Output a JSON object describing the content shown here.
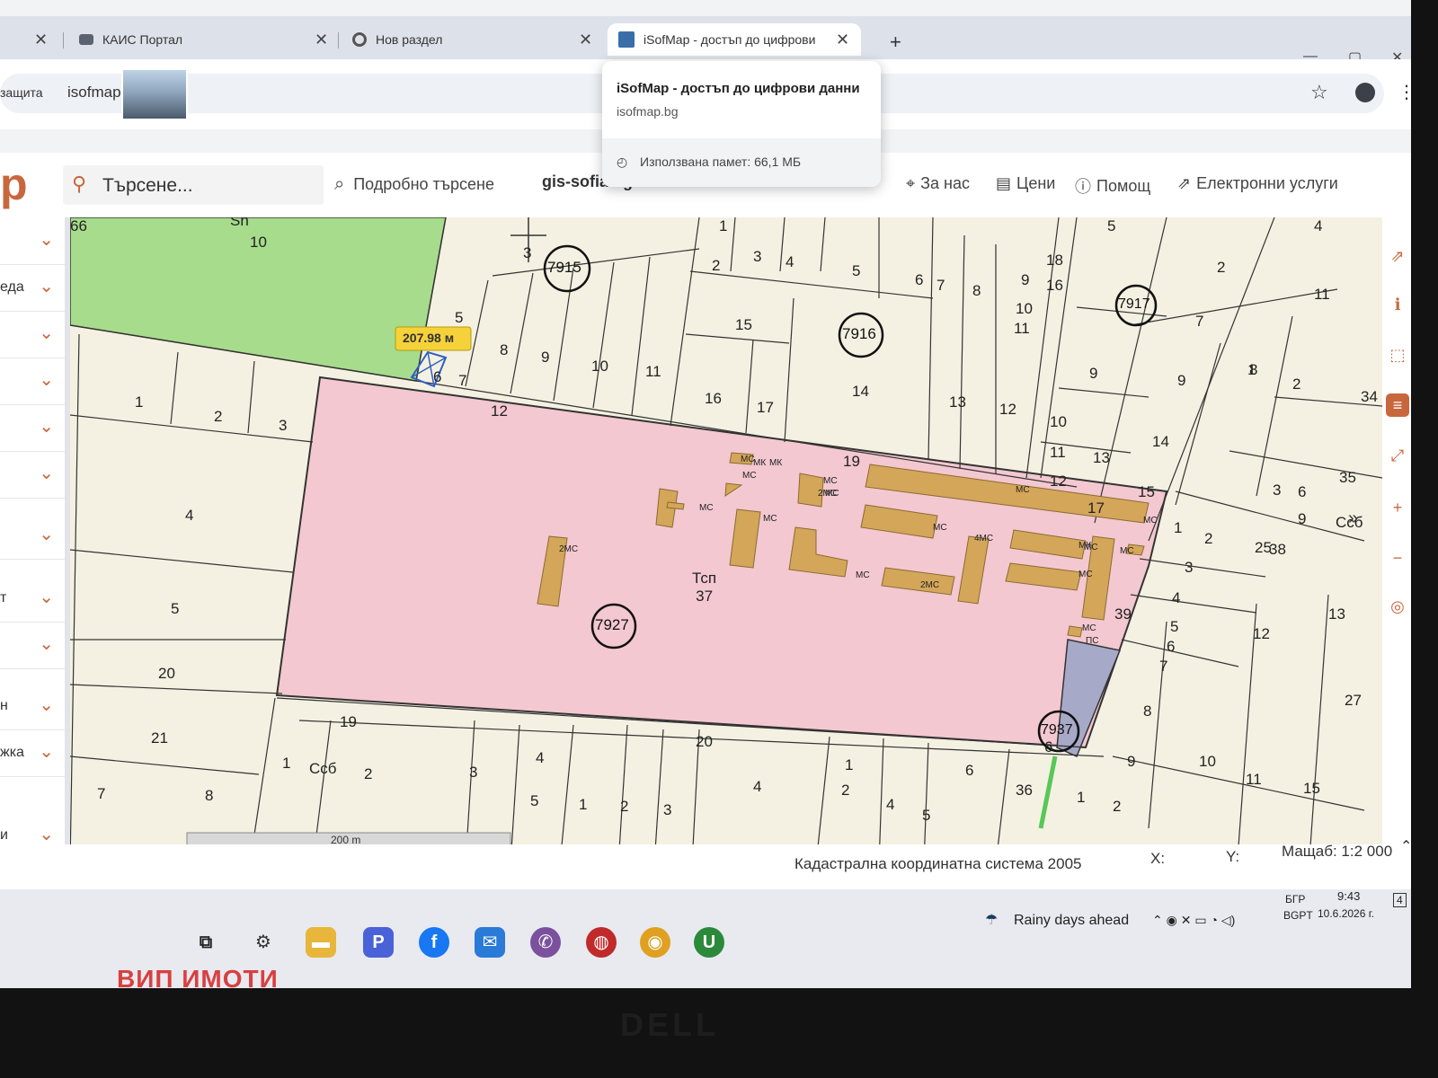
{
  "browser": {
    "tabs": [
      {
        "title": "КАИС Портал",
        "active": false
      },
      {
        "title": "Нов раздел",
        "active": false
      },
      {
        "title": "iSofMap - достъп до цифрови",
        "active": true
      }
    ],
    "new_tab_symbol": "+",
    "address_prefix": "защита",
    "address_text": "isofmap",
    "hover_card": {
      "title": "iSofMap - достъп до цифрови данни",
      "url": "isofmap.bg",
      "memory": "Използвана памет: 66,1 МБ"
    }
  },
  "app": {
    "logo_char": "p",
    "search_placeholder": "Търсене...",
    "advanced_search": "Подробно търсене",
    "gis_link": "gis-sofia.bg",
    "nav": [
      "За нас",
      "Цени",
      "Помощ",
      "Електронни услуги"
    ]
  },
  "sidebar": {
    "items": [
      {
        "label": ""
      },
      {
        "label": "еда"
      },
      {
        "label": ""
      },
      {
        "label": ""
      },
      {
        "label": ""
      },
      {
        "label": ""
      },
      {
        "label": ""
      },
      {
        "label": "т"
      },
      {
        "label": ""
      },
      {
        "label": "н"
      },
      {
        "label": "жка"
      },
      {
        "label": "и"
      }
    ]
  },
  "map": {
    "measure_label": "207.98 м",
    "main_parcel_type": "Тсп",
    "main_parcel_number": "37",
    "circled_blocks": [
      "7915",
      "7916",
      "7917",
      "7927",
      "7937"
    ],
    "parcel_numbers": [
      "10",
      "Sn",
      "1",
      "2",
      "3",
      "4",
      "5",
      "20",
      "21",
      "7",
      "8",
      "19",
      "1",
      "Ссб",
      "2",
      "3",
      "4",
      "5",
      "1",
      "2",
      "3",
      "20",
      "4",
      "1",
      "2",
      "4",
      "5",
      "6",
      "36",
      "3",
      "5",
      "8",
      "9",
      "10",
      "11",
      "6",
      "7",
      "12",
      "1",
      "2",
      "3",
      "4",
      "5",
      "15",
      "16",
      "17",
      "14",
      "13",
      "12",
      "19",
      "6",
      "7",
      "8",
      "9",
      "18",
      "16",
      "10",
      "11",
      "10",
      "11",
      "12",
      "13",
      "14",
      "15",
      "17",
      "9",
      "5",
      "2",
      "4",
      "11",
      "7",
      "9",
      "8",
      "1",
      "2",
      "3",
      "25",
      "38",
      "34",
      "35",
      "Ссб",
      "6",
      "9",
      "1",
      "2",
      "3",
      "4",
      "5",
      "6",
      "7",
      "39",
      "12",
      "13",
      "27",
      "8",
      "9",
      "10",
      "11",
      "15",
      "1",
      "2",
      "6",
      "66"
    ],
    "building_labels": [
      "МС",
      "МС",
      "МС",
      "МС",
      "МС",
      "2МС",
      "2МС",
      "МС",
      "МС",
      "МС",
      "МС",
      "4МС",
      "МС",
      "МС",
      "МК",
      "МК",
      "МК",
      "2МС",
      "МС",
      "МС",
      "МС",
      "ПС"
    ],
    "scalebar": "200 m"
  },
  "status": {
    "coord_system": "Кадастрална координатна система 2005",
    "x_label": "X:",
    "y_label": "Y:",
    "scale": "Мащаб: 1:2 000"
  },
  "taskbar": {
    "weather": "Rainy days ahead",
    "lang_top": "БГР",
    "lang_bottom": "BGPT",
    "time": "9:43",
    "date": "10.6.2026 г.",
    "notifications": "4"
  },
  "watermark": "ВИП ИМОТИ",
  "bezel_brand": "DELL",
  "colors": {
    "accent": "#c8673d",
    "parcel_pink": "#f3c8d0",
    "green_area": "#a6dc8c",
    "building": "#d4a65a",
    "road_gray": "#a7a9c8"
  }
}
